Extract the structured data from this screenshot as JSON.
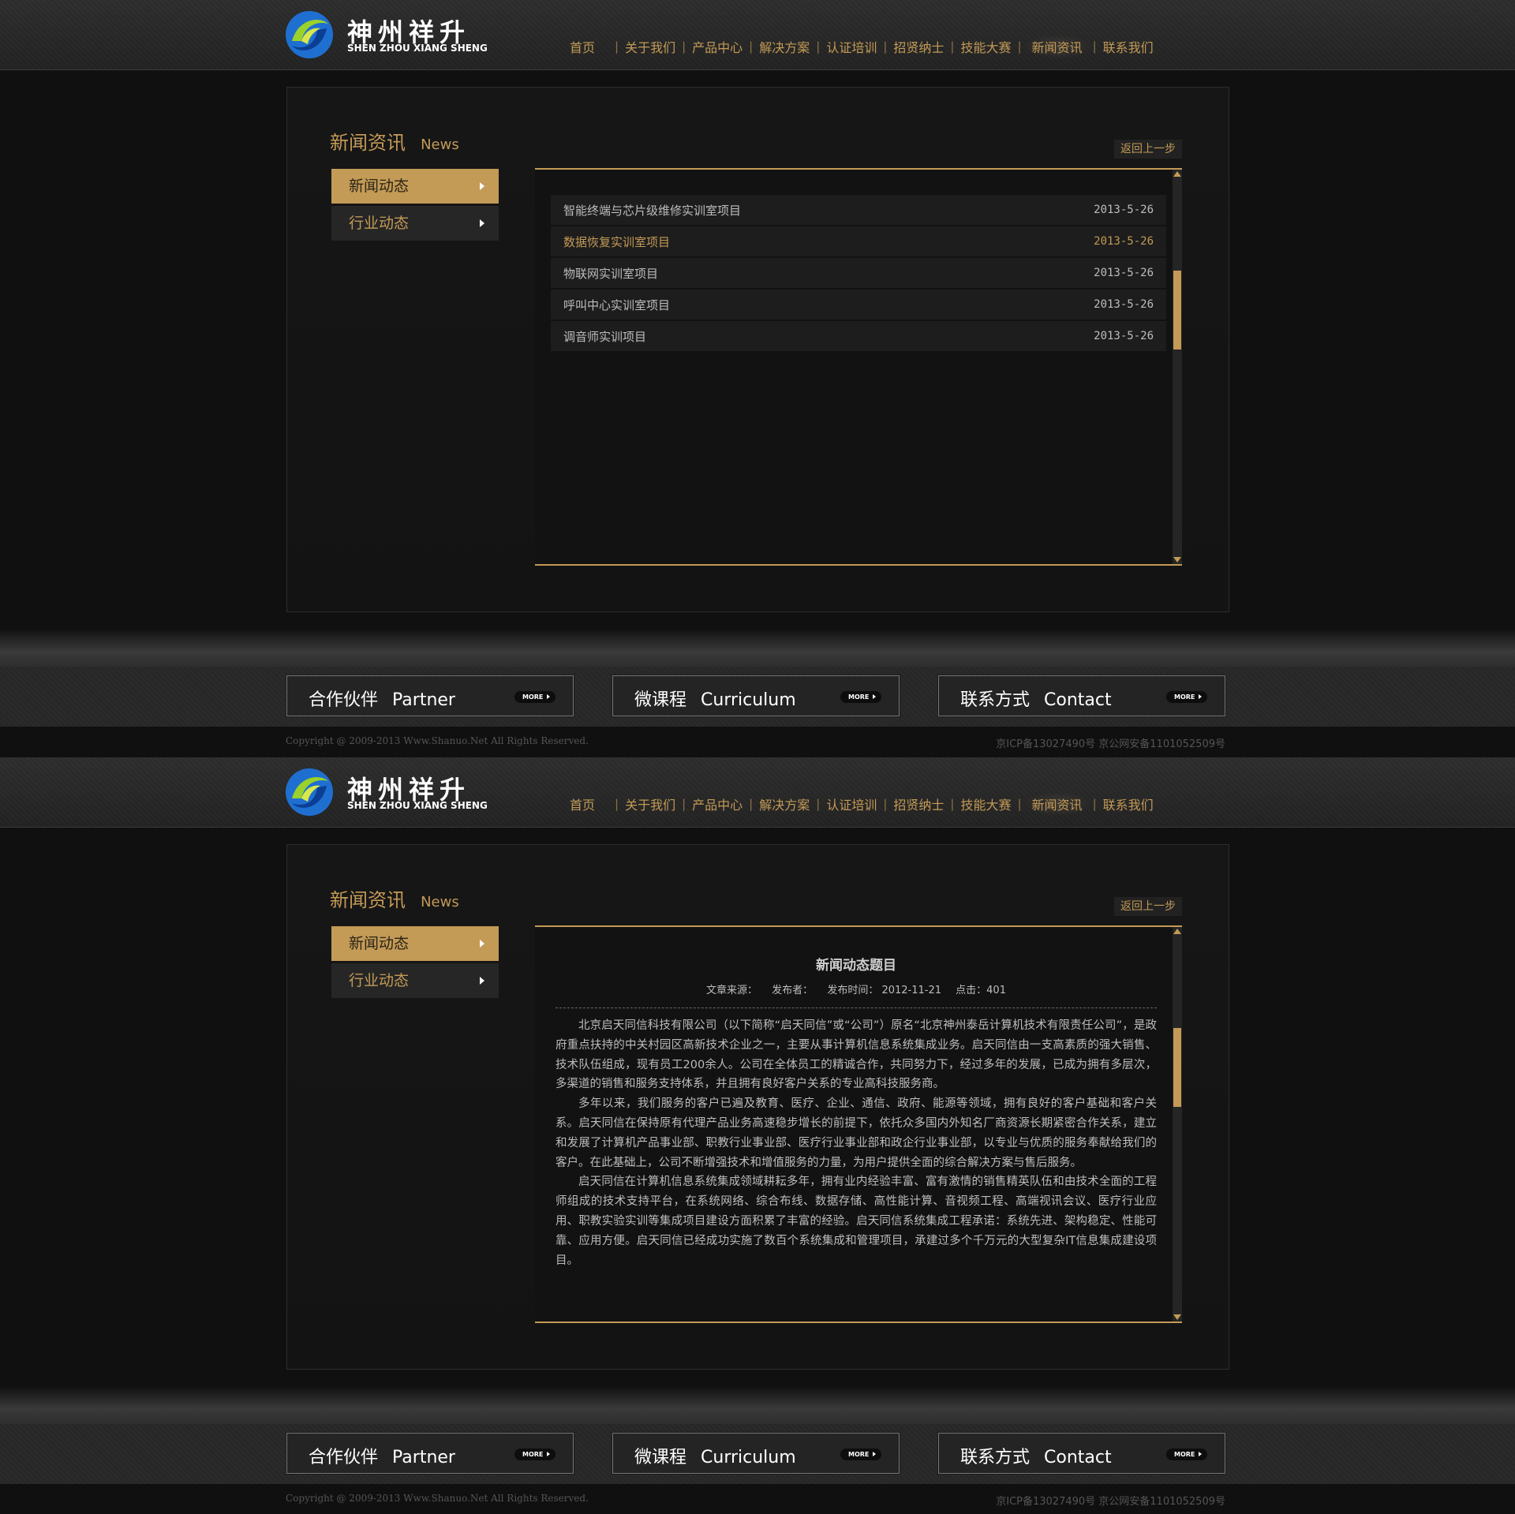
{
  "brand": {
    "name_cn": "神州祥升",
    "name_en": "SHEN ZHOU XIANG SHENG"
  },
  "nav": {
    "items": [
      "首页",
      "关于我们",
      "产品中心",
      "解决方案",
      "认证培训",
      "招贤纳士",
      "技能大赛",
      "新闻资讯",
      "联系我们"
    ],
    "active": "新闻资讯"
  },
  "section": {
    "title_cn": "新闻资讯",
    "title_en": "News",
    "back_label": "返回上一步"
  },
  "side_menu": {
    "items": [
      "新闻动态",
      "行业动态"
    ],
    "active": "新闻动态"
  },
  "news_list": [
    {
      "title": "智能终端与芯片级维修实训室项目",
      "date": "2013-5-26"
    },
    {
      "title": "数据恢复实训室项目",
      "date": "2013-5-26"
    },
    {
      "title": "物联网实训室项目",
      "date": "2013-5-26"
    },
    {
      "title": "呼叫中心实训室项目",
      "date": "2013-5-26"
    },
    {
      "title": "调音师实训项目",
      "date": "2013-5-26"
    }
  ],
  "article": {
    "title": "新闻动态题目",
    "meta": {
      "source": "文章来源：",
      "author": "发布者：",
      "time": "发布时间： 2012-11-21",
      "clicks": "点击：401"
    },
    "paragraphs": [
      "北京启天同信科技有限公司（以下简称“启天同信”或“公司”）原名“北京神州泰岳计算机技术有限责任公司”，是政府重点扶持的中关村园区高新技术企业之一，主要从事计算机信息系统集成业务。启天同信由一支高素质的强大销售、技术队伍组成，现有员工200余人。公司在全体员工的精诚合作，共同努力下，经过多年的发展，已成为拥有多层次，多渠道的销售和服务支持体系，并且拥有良好客户关系的专业高科技服务商。",
      "多年以来，我们服务的客户已遍及教育、医疗、企业、通信、政府、能源等领域，拥有良好的客户基础和客户关系。启天同信在保持原有代理产品业务高速稳步增长的前提下，依托众多国内外知名厂商资源长期紧密合作关系，建立和发展了计算机产品事业部、职教行业事业部、医疗行业事业部和政企行业事业部，以专业与优质的服务奉献给我们的客户。在此基础上，公司不断增强技术和增值服务的力量，为用户提供全面的综合解决方案与售后服务。",
      "启天同信在计算机信息系统集成领域耕耘多年，拥有业内经验丰富、富有激情的销售精英队伍和由技术全面的工程师组成的技术支持平台，在系统网络、综合布线、数据存储、高性能计算、音视频工程、高端视讯会议、医疗行业应用、职教实验实训等集成项目建设方面积累了丰富的经验。启天同信系统集成工程承诺：系统先进、架构稳定、性能可靠、应用方便。启天同信已经成功实施了数百个系统集成和管理项目，承建过多个千万元的大型复杂IT信息集成建设项目。"
    ]
  },
  "footer_boxes": [
    {
      "cn": "合作伙伴",
      "en": "Partner",
      "more": "MORE"
    },
    {
      "cn": "微课程",
      "en": "Curriculum",
      "more": "MORE"
    },
    {
      "cn": "联系方式",
      "en": "Contact",
      "more": "MORE"
    }
  ],
  "footer": {
    "copyright": "Copyright @ 2009-2013 Www.Shanuo.Net All Rights Reserved.",
    "icp": "京ICP备13027490号 京公网安备1101052509号"
  },
  "colors": {
    "accent": "#c39a56",
    "background": "#101010",
    "panel": "#161616"
  },
  "icons": [
    "logo-swirl-icon",
    "chevron-right-icon",
    "scroll-up-arrow-icon",
    "scroll-down-arrow-icon",
    "more-arrow-icon"
  ]
}
